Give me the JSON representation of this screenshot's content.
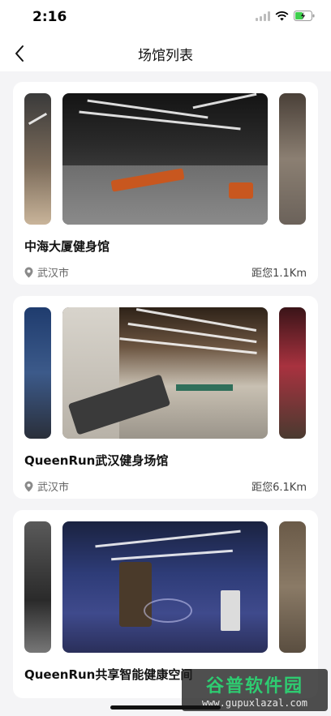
{
  "status_bar": {
    "time": "2:16"
  },
  "nav": {
    "title": "场馆列表"
  },
  "venues": [
    {
      "name": "中海大厦健身馆",
      "city": "武汉市",
      "distance": "距您1.1Km"
    },
    {
      "name": "QueenRun武汉健身场馆",
      "city": "武汉市",
      "distance": "距您6.1Km"
    },
    {
      "name": "QueenRun共享智能健康空间"
    }
  ],
  "watermark": {
    "logo": "谷普软件园",
    "url": "www.gupuxlazal.com"
  },
  "colors": {
    "background": "#f4f4f6",
    "card": "#ffffff",
    "battery": "#3fcf4e",
    "text_secondary": "#666666"
  }
}
